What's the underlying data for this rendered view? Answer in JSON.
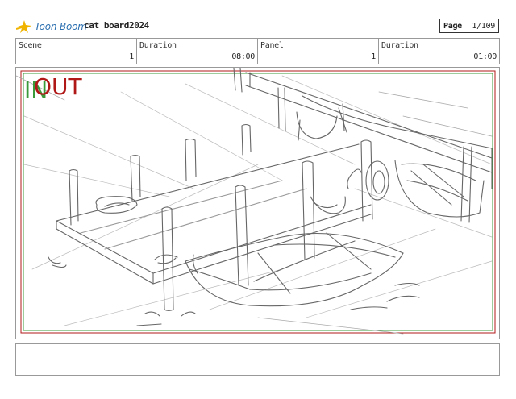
{
  "header": {
    "logo_text": "Toon Boom",
    "project_title": "cat board2024",
    "page_label": "Page",
    "page_value": "1/109"
  },
  "info": {
    "scene_label": "Scene",
    "scene_value": "1",
    "scene_duration_label": "Duration",
    "scene_duration_value": "08:00",
    "panel_label": "Panel",
    "panel_value": "1",
    "panel_duration_label": "Duration",
    "panel_duration_value": "01:00"
  },
  "panel": {
    "in_marker": "IN",
    "out_marker": "OUT"
  },
  "colors": {
    "in_green": "#3a9a3a",
    "out_red": "#b01818",
    "logo_blue": "#2b6fb0",
    "logo_yellow": "#f0b400"
  },
  "icons": {
    "logo": "toon-boom-star-icon"
  }
}
